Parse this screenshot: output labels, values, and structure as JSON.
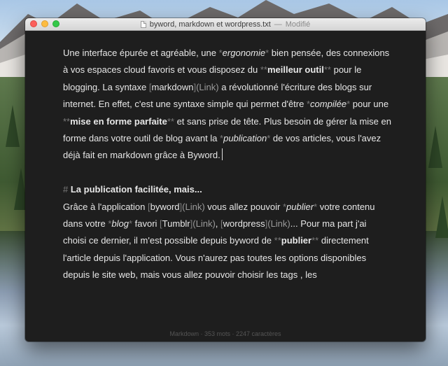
{
  "window": {
    "title": "byword, markdown et wordpress.txt",
    "separator": "—",
    "state": "Modifié"
  },
  "document": {
    "p1": {
      "t1": "Une interface épurée et agréable, une ",
      "m1a": "*",
      "e1": "ergonomie",
      "m1b": "*",
      "t2": " bien pensée, des connexions à vos espaces cloud favoris et vous disposez du ",
      "m2a": "**",
      "b1": "meilleur outil",
      "m2b": "**",
      "t3": " pour le blogging. La syntaxe ",
      "l1o": "[",
      "l1": "markdown",
      "l1c": "]",
      "l1u": "(Link)",
      "t4": " a révolutionné l'écriture des blogs sur internet. En effet, c'est une syntaxe simple qui permet d'être ",
      "m3a": "*",
      "e2": "compilée",
      "m3b": "*",
      "t5": " pour une ",
      "m4a": "**",
      "b2": "mise en forme parfaite",
      "m4b": "**",
      "t6": " et sans prise de tête. Plus besoin de gérer la mise en forme dans votre outil de blog avant la ",
      "m5a": "*",
      "e3": "publication",
      "m5b": "*",
      "t7": " de vos articles, vous l'avez déjà fait en markdown grâce à Byword."
    },
    "heading": {
      "marker": "#",
      "text": "La publication facilitée, mais..."
    },
    "p2": {
      "t1": "Grâce à l'application ",
      "l1o": "[",
      "l1": "byword",
      "l1c": "]",
      "l1u": "(Link)",
      "t2": " vous allez pouvoir ",
      "m1a": "*",
      "e1": "publier",
      "m1b": "*",
      "t3": " votre contenu dans votre ",
      "m2a": "*",
      "e2": "blog",
      "m2b": "*",
      "t4": " favori ",
      "l2o": "[",
      "l2": "Tumblr",
      "l2c": "]",
      "l2u": "(Link)",
      "t5": ", ",
      "l3o": "[",
      "l3": "wordpress",
      "l3c": "]",
      "l3u": "(Link)",
      "t6": "... Pour ma part j'ai choisi ce dernier, il m'est possible depuis byword de ",
      "m3a": "**",
      "b1": "publier",
      "m3b": "**",
      "t7": " directement l'article depuis l'application. Vous n'aurez pas toutes les options disponibles depuis le site web, mais vous allez pouvoir choisir les tags , les"
    }
  },
  "status": {
    "text": "Markdown · 353 mots · 2247 caractères"
  },
  "colors": {
    "editor_bg": "#1e1e1e",
    "text": "#e7e7e7",
    "markup": "#7b7b7b"
  },
  "icons": [
    "close-icon",
    "minimize-icon",
    "zoom-icon",
    "document-icon"
  ]
}
